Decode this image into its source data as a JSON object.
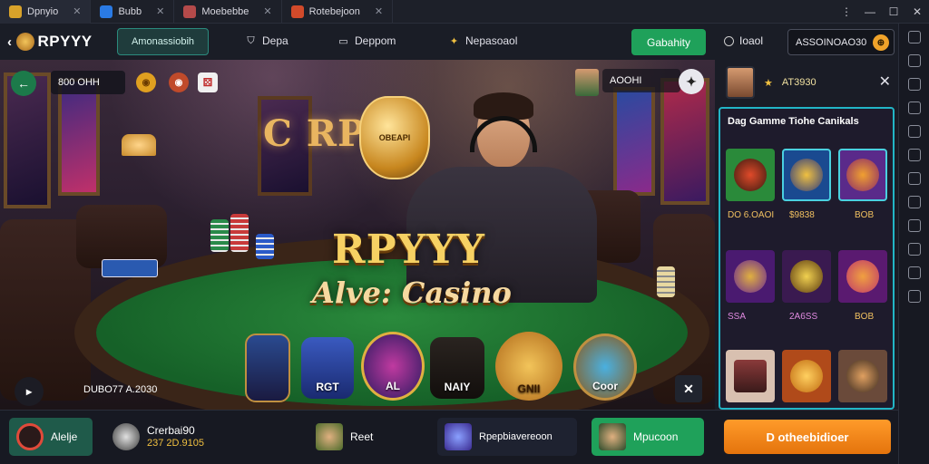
{
  "titlebar": {
    "tabs": [
      {
        "label": "Dpnyio"
      },
      {
        "label": "Bubb"
      },
      {
        "label": "Moebebbe"
      },
      {
        "label": "Rotebejoon"
      }
    ]
  },
  "nav": {
    "logo": "RPYYY",
    "pill": "Amonassiobih",
    "links": [
      {
        "label": "Depa"
      },
      {
        "label": "Deppom"
      },
      {
        "label": "Nepasoaol"
      }
    ],
    "action": "Gabahity",
    "login": "Ioaol",
    "balance": "ASSOINOAO30"
  },
  "stage": {
    "top_left_label": "800 OHH",
    "top_right_label": "AOOHI",
    "wall_word": "C RPYY",
    "emblem_text": "OBEAPI",
    "brand_title": "RPYYY",
    "brand_subtitle": "Alve: Casino",
    "bottom_label": "DUBO77 A.2030",
    "games": [
      {
        "label": ""
      },
      {
        "label": "RGT"
      },
      {
        "label": "AL"
      },
      {
        "label": "NAIY"
      },
      {
        "label": "GNII"
      },
      {
        "label": "Coor"
      }
    ]
  },
  "panel": {
    "user": "AT3930",
    "title": "Dag Gamme Tiohe Canikals",
    "row1_labels": [
      "DO 6.OAOI",
      "$9838",
      "BOB"
    ],
    "row2_labels": [
      "SSA",
      "2A6SS",
      "BOB"
    ]
  },
  "bottom": {
    "btn1": "Alelje",
    "user_name": "Crerbai90",
    "user_sub": "237 2D.9105",
    "btn3": "Reet",
    "btn4": "Rpepbiavereoon",
    "btn5": "Mpucoon",
    "cta": "D otheebidioer"
  }
}
